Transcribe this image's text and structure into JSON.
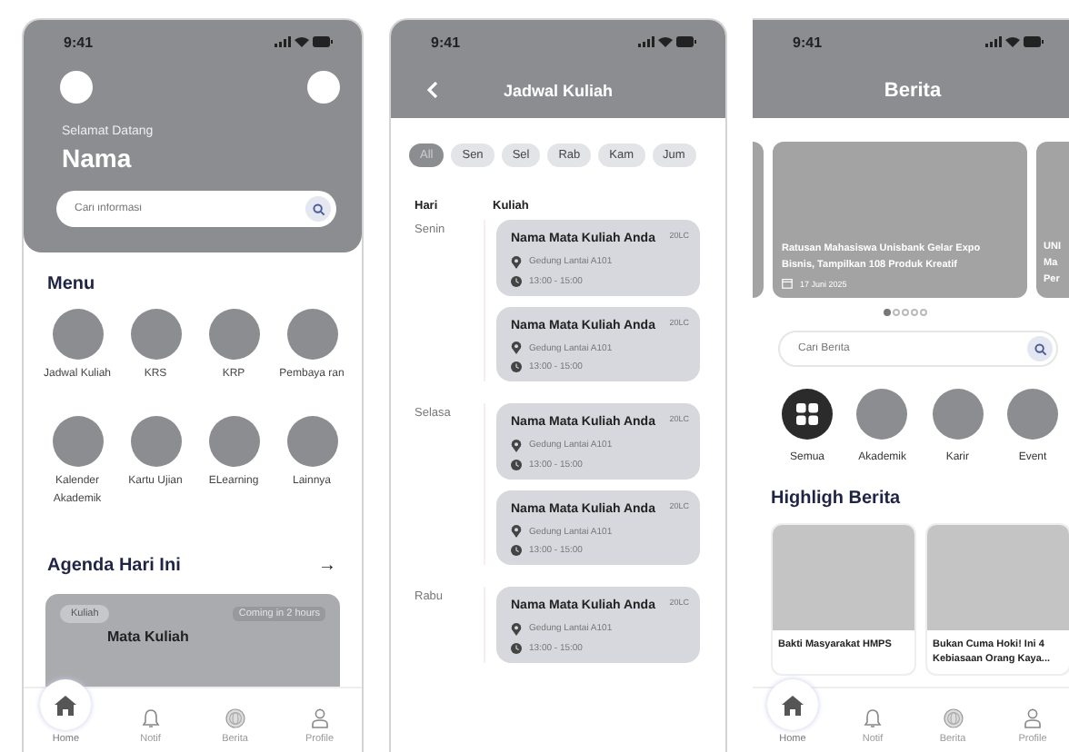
{
  "home": {
    "status_time": "9:41",
    "greeting": "Selamat Datang",
    "name": "Nama",
    "search": {
      "placeholder": "Cari informasi"
    },
    "menu_title": "Menu",
    "menu": [
      {
        "label": "Jadwal Kuliah"
      },
      {
        "label": "KRS"
      },
      {
        "label": "KRP"
      },
      {
        "label": "Pembaya ran"
      },
      {
        "label": "Kalender Akademik"
      },
      {
        "label": "Kartu Ujian"
      },
      {
        "label": "ELearning"
      },
      {
        "label": "Lainnya"
      }
    ],
    "agenda_title": "Agenda Hari Ini",
    "agenda_arrow": "→",
    "agenda_card": {
      "tag": "Kuliah",
      "time": "Coming in 2 hours",
      "title": "Mata Kuliah"
    },
    "nav": [
      {
        "kind": "home",
        "label": "Home",
        "selected": true
      },
      {
        "kind": "bell",
        "label": "Notif",
        "selected": false
      },
      {
        "kind": "globe",
        "label": "Berita",
        "selected": false
      },
      {
        "kind": "person",
        "label": "Profile",
        "selected": false
      }
    ]
  },
  "schedule": {
    "status_time": "9:41",
    "title": "Jadwal Kuliah",
    "filters": [
      {
        "label": "All",
        "selected": true
      },
      {
        "label": "Sen",
        "selected": false
      },
      {
        "label": "Sel",
        "selected": false
      },
      {
        "label": "Rab",
        "selected": false
      },
      {
        "label": "Kam",
        "selected": false
      },
      {
        "label": "Jum",
        "selected": false
      }
    ],
    "columns": [
      "Hari",
      "Kuliah"
    ],
    "days": [
      {
        "day": "Senin",
        "classes": [
          {
            "title": "Nama Mata Kuliah Anda",
            "code": "20LC",
            "room": "Gedung Lantai A101",
            "time": "13:00 - 15:00"
          },
          {
            "title": "Nama Mata Kuliah Anda",
            "code": "20LC",
            "room": "Gedung Lantai A101",
            "time": "13:00 - 15:00"
          }
        ]
      },
      {
        "day": "Selasa",
        "classes": [
          {
            "title": "Nama Mata Kuliah Anda",
            "code": "20LC",
            "room": "Gedung Lantai A101",
            "time": "13:00 - 15:00"
          },
          {
            "title": "Nama Mata Kuliah Anda",
            "code": "20LC",
            "room": "Gedung Lantai A101",
            "time": "13:00 - 15:00"
          }
        ]
      },
      {
        "day": "Rabu",
        "classes": [
          {
            "title": "Nama Mata Kuliah Anda",
            "code": "20LC",
            "room": "Gedung Lantai A101",
            "time": "13:00 - 15:00"
          }
        ]
      }
    ]
  },
  "news": {
    "status_time": "9:41",
    "title": "Berita",
    "carousel": [
      {
        "lines": [
          "Ratusan Mahasiswa Unisbank Gelar Expo",
          "Bisnis, Tampilkan 108 Produk Kreatif"
        ],
        "date": "17 Juni 2025"
      },
      {
        "lines": [
          "UNI",
          "Ma",
          "Per"
        ]
      }
    ],
    "dots": [
      {
        "selected": true
      },
      {
        "selected": false
      },
      {
        "selected": false
      },
      {
        "selected": false
      },
      {
        "selected": false
      }
    ],
    "search": {
      "placeholder": "Cari Berita"
    },
    "categories": [
      {
        "label": "Semua",
        "selected": true
      },
      {
        "label": "Akademik",
        "selected": false
      },
      {
        "label": "Karir",
        "selected": false
      },
      {
        "label": "Event",
        "selected": false
      }
    ],
    "highlight_title": "Highligh Berita",
    "highlights": [
      {
        "title": "Bakti Masyarakat HMPS"
      },
      {
        "title": "Bukan Cuma Hoki! Ini 4 Kebiasaan Orang Kaya..."
      }
    ],
    "nav": [
      {
        "kind": "home",
        "label": "Home",
        "selected": true
      },
      {
        "kind": "bell",
        "label": "Notif",
        "selected": false
      },
      {
        "kind": "globe",
        "label": "Berita",
        "selected": false
      },
      {
        "kind": "person",
        "label": "Profile",
        "selected": false
      }
    ]
  }
}
